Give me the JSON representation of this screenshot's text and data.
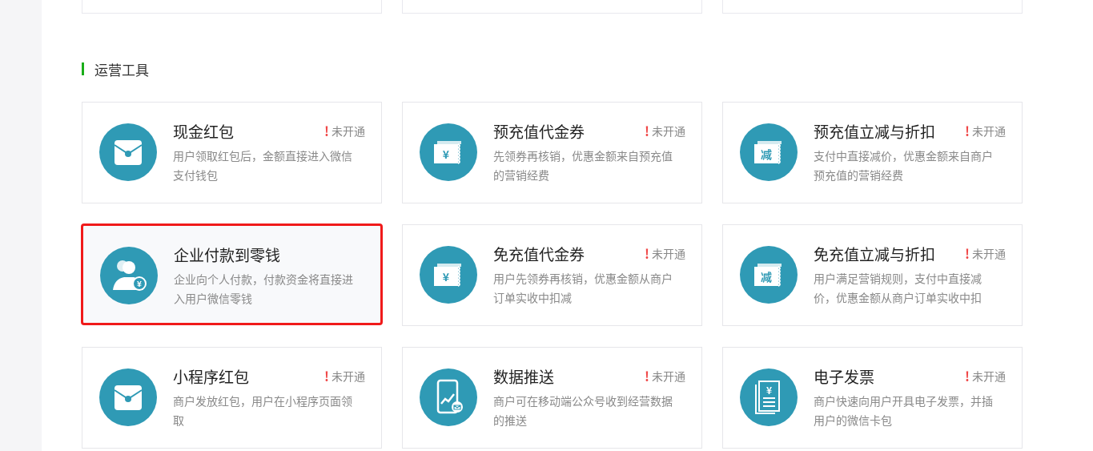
{
  "section": {
    "title": "运营工具"
  },
  "cards": [
    {
      "kind": "envelope",
      "title": "现金红包",
      "status": {
        "mark": "!",
        "label": "未开通"
      },
      "description": "用户领取红包后，金额直接进入微信支付钱包",
      "selected": false
    },
    {
      "kind": "voucher",
      "icon_text": "¥",
      "title": "预充值代金券",
      "status": {
        "mark": "!",
        "label": "未开通"
      },
      "description": "先领券再核销，优惠金额来自预充值的营销经费",
      "selected": false
    },
    {
      "kind": "voucher",
      "icon_text": "减",
      "title": "预充值立减与折扣",
      "status": {
        "mark": "!",
        "label": "未开通"
      },
      "description": "支付中直接减价，优惠金额来自商户预充值的营销经费",
      "selected": false
    },
    {
      "kind": "people",
      "icon_text": "¥",
      "title": "企业付款到零钱",
      "description": "企业向个人付款，付款资金将直接进入用户微信零钱",
      "selected": true
    },
    {
      "kind": "voucher",
      "icon_text": "¥",
      "title": "免充值代金券",
      "status": {
        "mark": "!",
        "label": "未开通"
      },
      "description": "用户先领券再核销，优惠金额从商户订单实收中扣减",
      "selected": false
    },
    {
      "kind": "voucher",
      "icon_text": "减",
      "title": "免充值立减与折扣",
      "status": {
        "mark": "!",
        "label": "未开通"
      },
      "description": "用户满足营销规则，支付中直接减价，优惠金额从商户订单实收中扣",
      "selected": false
    },
    {
      "kind": "envelope",
      "title": "小程序红包",
      "status": {
        "mark": "!",
        "label": "未开通"
      },
      "description": "商户发放红包，用户在小程序页面领取",
      "selected": false
    },
    {
      "kind": "phone",
      "title": "数据推送",
      "status": {
        "mark": "!",
        "label": "未开通"
      },
      "description": "商户可在移动端公众号收到经营数据的推送",
      "selected": false
    },
    {
      "kind": "invoice",
      "icon_text": "¥",
      "title": "电子发票",
      "status": {
        "mark": "!",
        "label": "未开通"
      },
      "description": "商户快速向用户开具电子发票，并插用户的微信卡包",
      "selected": false
    }
  ]
}
